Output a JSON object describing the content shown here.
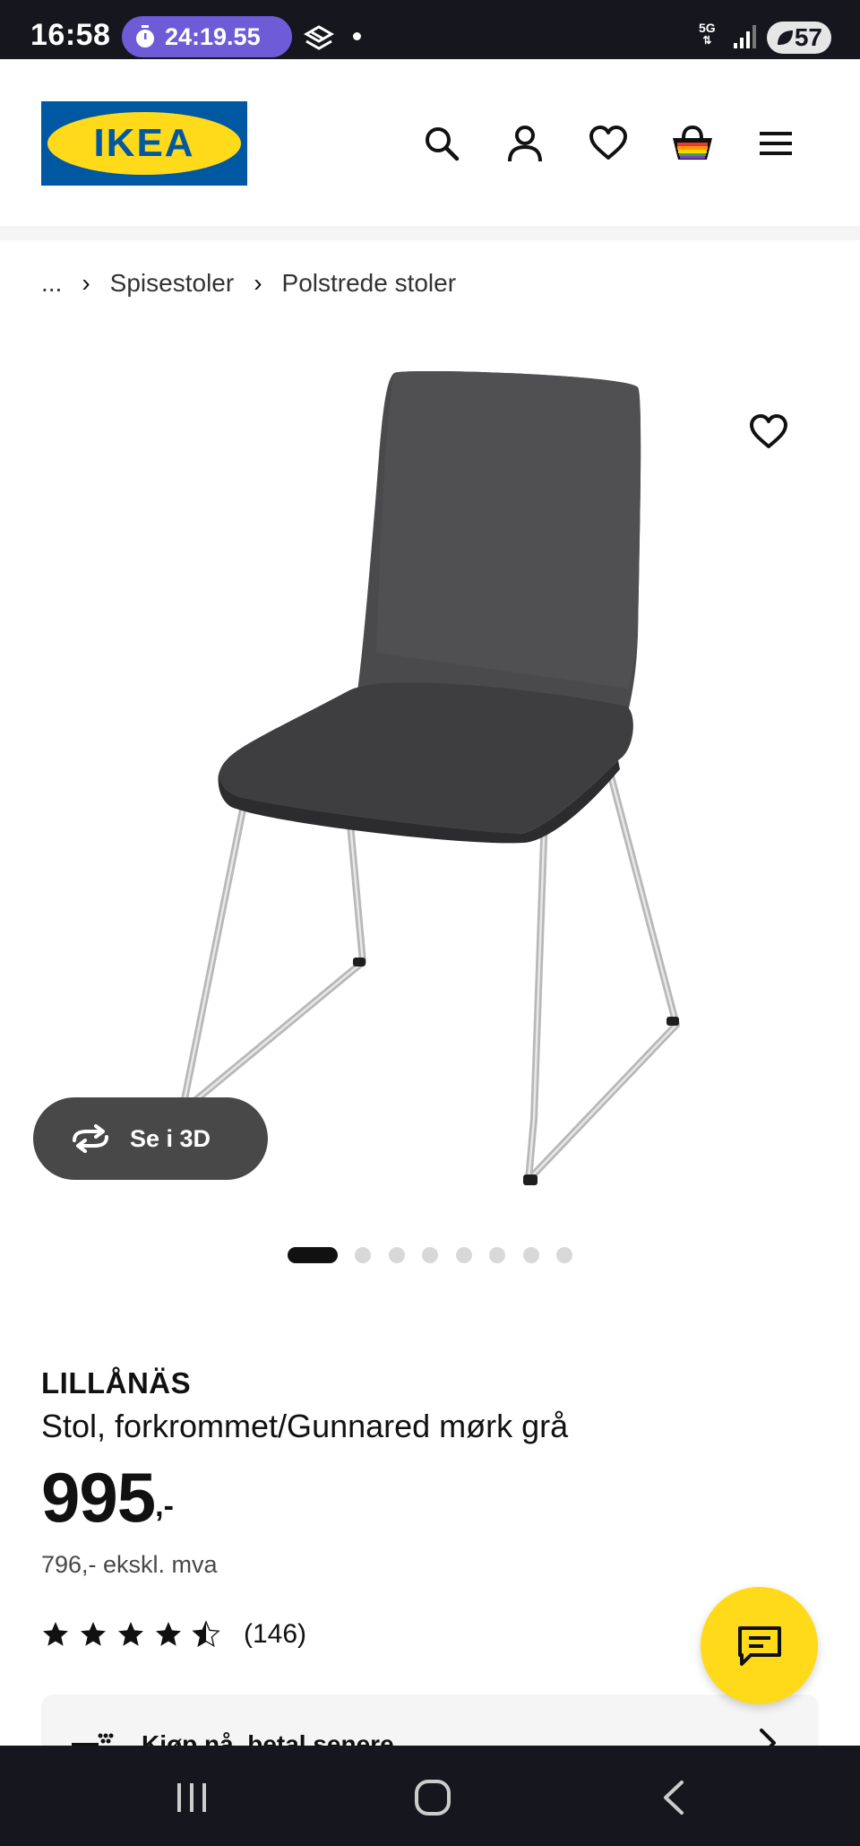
{
  "status_bar": {
    "time": "16:58",
    "timer": "24:19.55",
    "network": "5G",
    "battery": "57"
  },
  "header": {
    "logo_text": "IKEA",
    "icons": [
      "search-icon",
      "account-icon",
      "heart-icon",
      "basket-icon",
      "menu-icon"
    ]
  },
  "breadcrumb": {
    "ellipsis": "...",
    "items": [
      "Spisestoler",
      "Polstrede stoler"
    ]
  },
  "gallery": {
    "button_3d_label": "Se i 3D",
    "image_count": 8,
    "active_index": 0
  },
  "product": {
    "name": "LILLÅNÄS",
    "description": "Stol, forkrommet/Gunnared mørk grå",
    "price_main": "995",
    "price_suffix": ",-",
    "price_ex_vat": "796,- ekskl. mva",
    "rating_value": 4.5,
    "rating_max": 5,
    "rating_count": "(146)"
  },
  "payment_banner": {
    "label": "Kjøp nå, betal senere"
  },
  "colors": {
    "ikea_blue": "#0058a3",
    "ikea_yellow": "#ffda1a",
    "status_bar_bg": "#16161e",
    "timer_pill": "#6e5bd8",
    "button_3d_bg": "#484848"
  }
}
